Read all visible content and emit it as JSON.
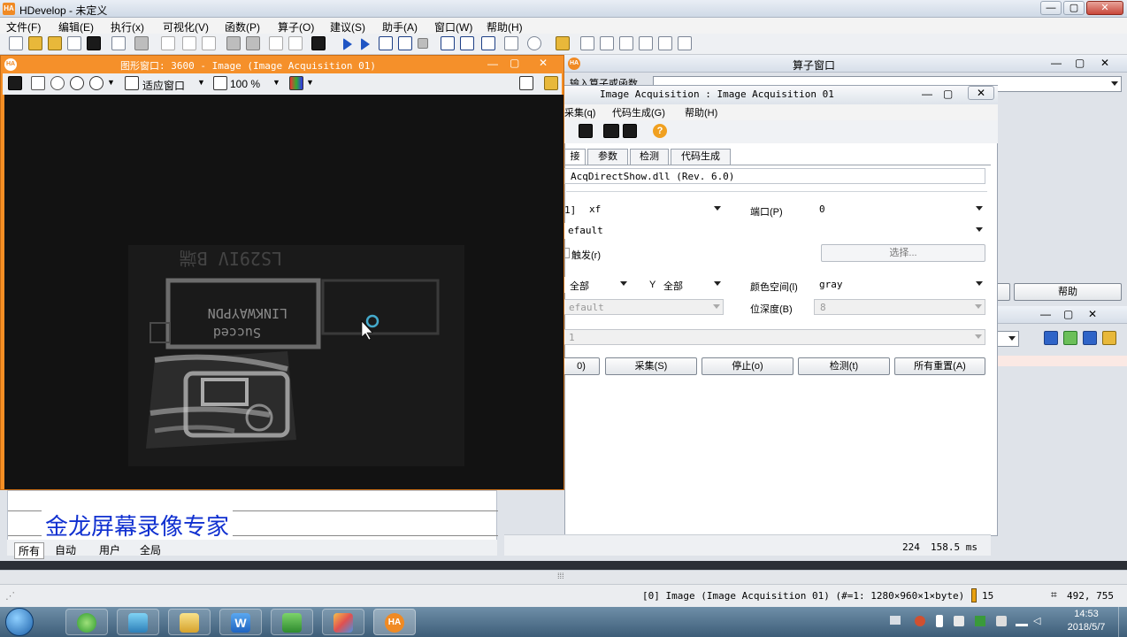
{
  "app": {
    "title": "HDevelop - 未定义",
    "logo": "HA"
  },
  "menu": [
    "文件(F)",
    "编辑(E)",
    "执行(x)",
    "可视化(V)",
    "函数(P)",
    "算子(O)",
    "建议(S)",
    "助手(A)",
    "窗口(W)",
    "帮助(H)"
  ],
  "graphics_window": {
    "title": "图形窗口: 3600 - Image (Image Acquisition 01)",
    "fit_label": "适应窗口",
    "zoom": "100 %",
    "image_text": {
      "sticker_top": "LINKWAYPDN",
      "sticker_bottom": "Succed",
      "model": "LS29IV B端"
    }
  },
  "operator_window": {
    "title": "算子窗口",
    "input_label": "输入算子或函数",
    "help_button": "帮助"
  },
  "acq_window": {
    "title": "Image Acquisition : Image Acquisition 01",
    "menu": [
      "采集(q)",
      "代码生成(G)",
      "帮助(H)"
    ],
    "tabs": [
      "接",
      "参数",
      "检测",
      "代码生成"
    ],
    "interface": "AcqDirectShow.dll (Rev. 6.0)",
    "device_label": "1]",
    "device_value": "xf",
    "port_label": "端口(P)",
    "port_value": "0",
    "camera_type": "efault",
    "trigger_label": "触发(r)",
    "select_button": "选择...",
    "x_value": "全部",
    "y_label": "Y",
    "y_value": "全部",
    "color_space_label": "颜色空间(l)",
    "color_space_value": "gray",
    "field_value": "efault",
    "bit_depth_label": "位深度(B)",
    "bit_depth_value": "8",
    "line_value": "1",
    "buttons": [
      "0)",
      "采集(S)",
      "停止(o)",
      "检测(t)",
      "所有重置(A)"
    ],
    "frame_count": "224",
    "frame_time": "158.5 ms"
  },
  "lower_panel": {
    "watermark": "金龙屏幕录像专家",
    "tabs": [
      "所有",
      "自动",
      "用户",
      "全局"
    ]
  },
  "status_bar": {
    "image_info": "[0] Image (Image Acquisition 01) (#=1: 1280×960×1×byte)",
    "gray_value": "15",
    "coords": "492, 755"
  },
  "taskbar": {
    "time": "14:53",
    "date": "2018/5/7",
    "apps": [
      "start-orb",
      "browser",
      "camera",
      "explorer",
      "wps-writer",
      "office",
      "paint",
      "halcon"
    ]
  }
}
